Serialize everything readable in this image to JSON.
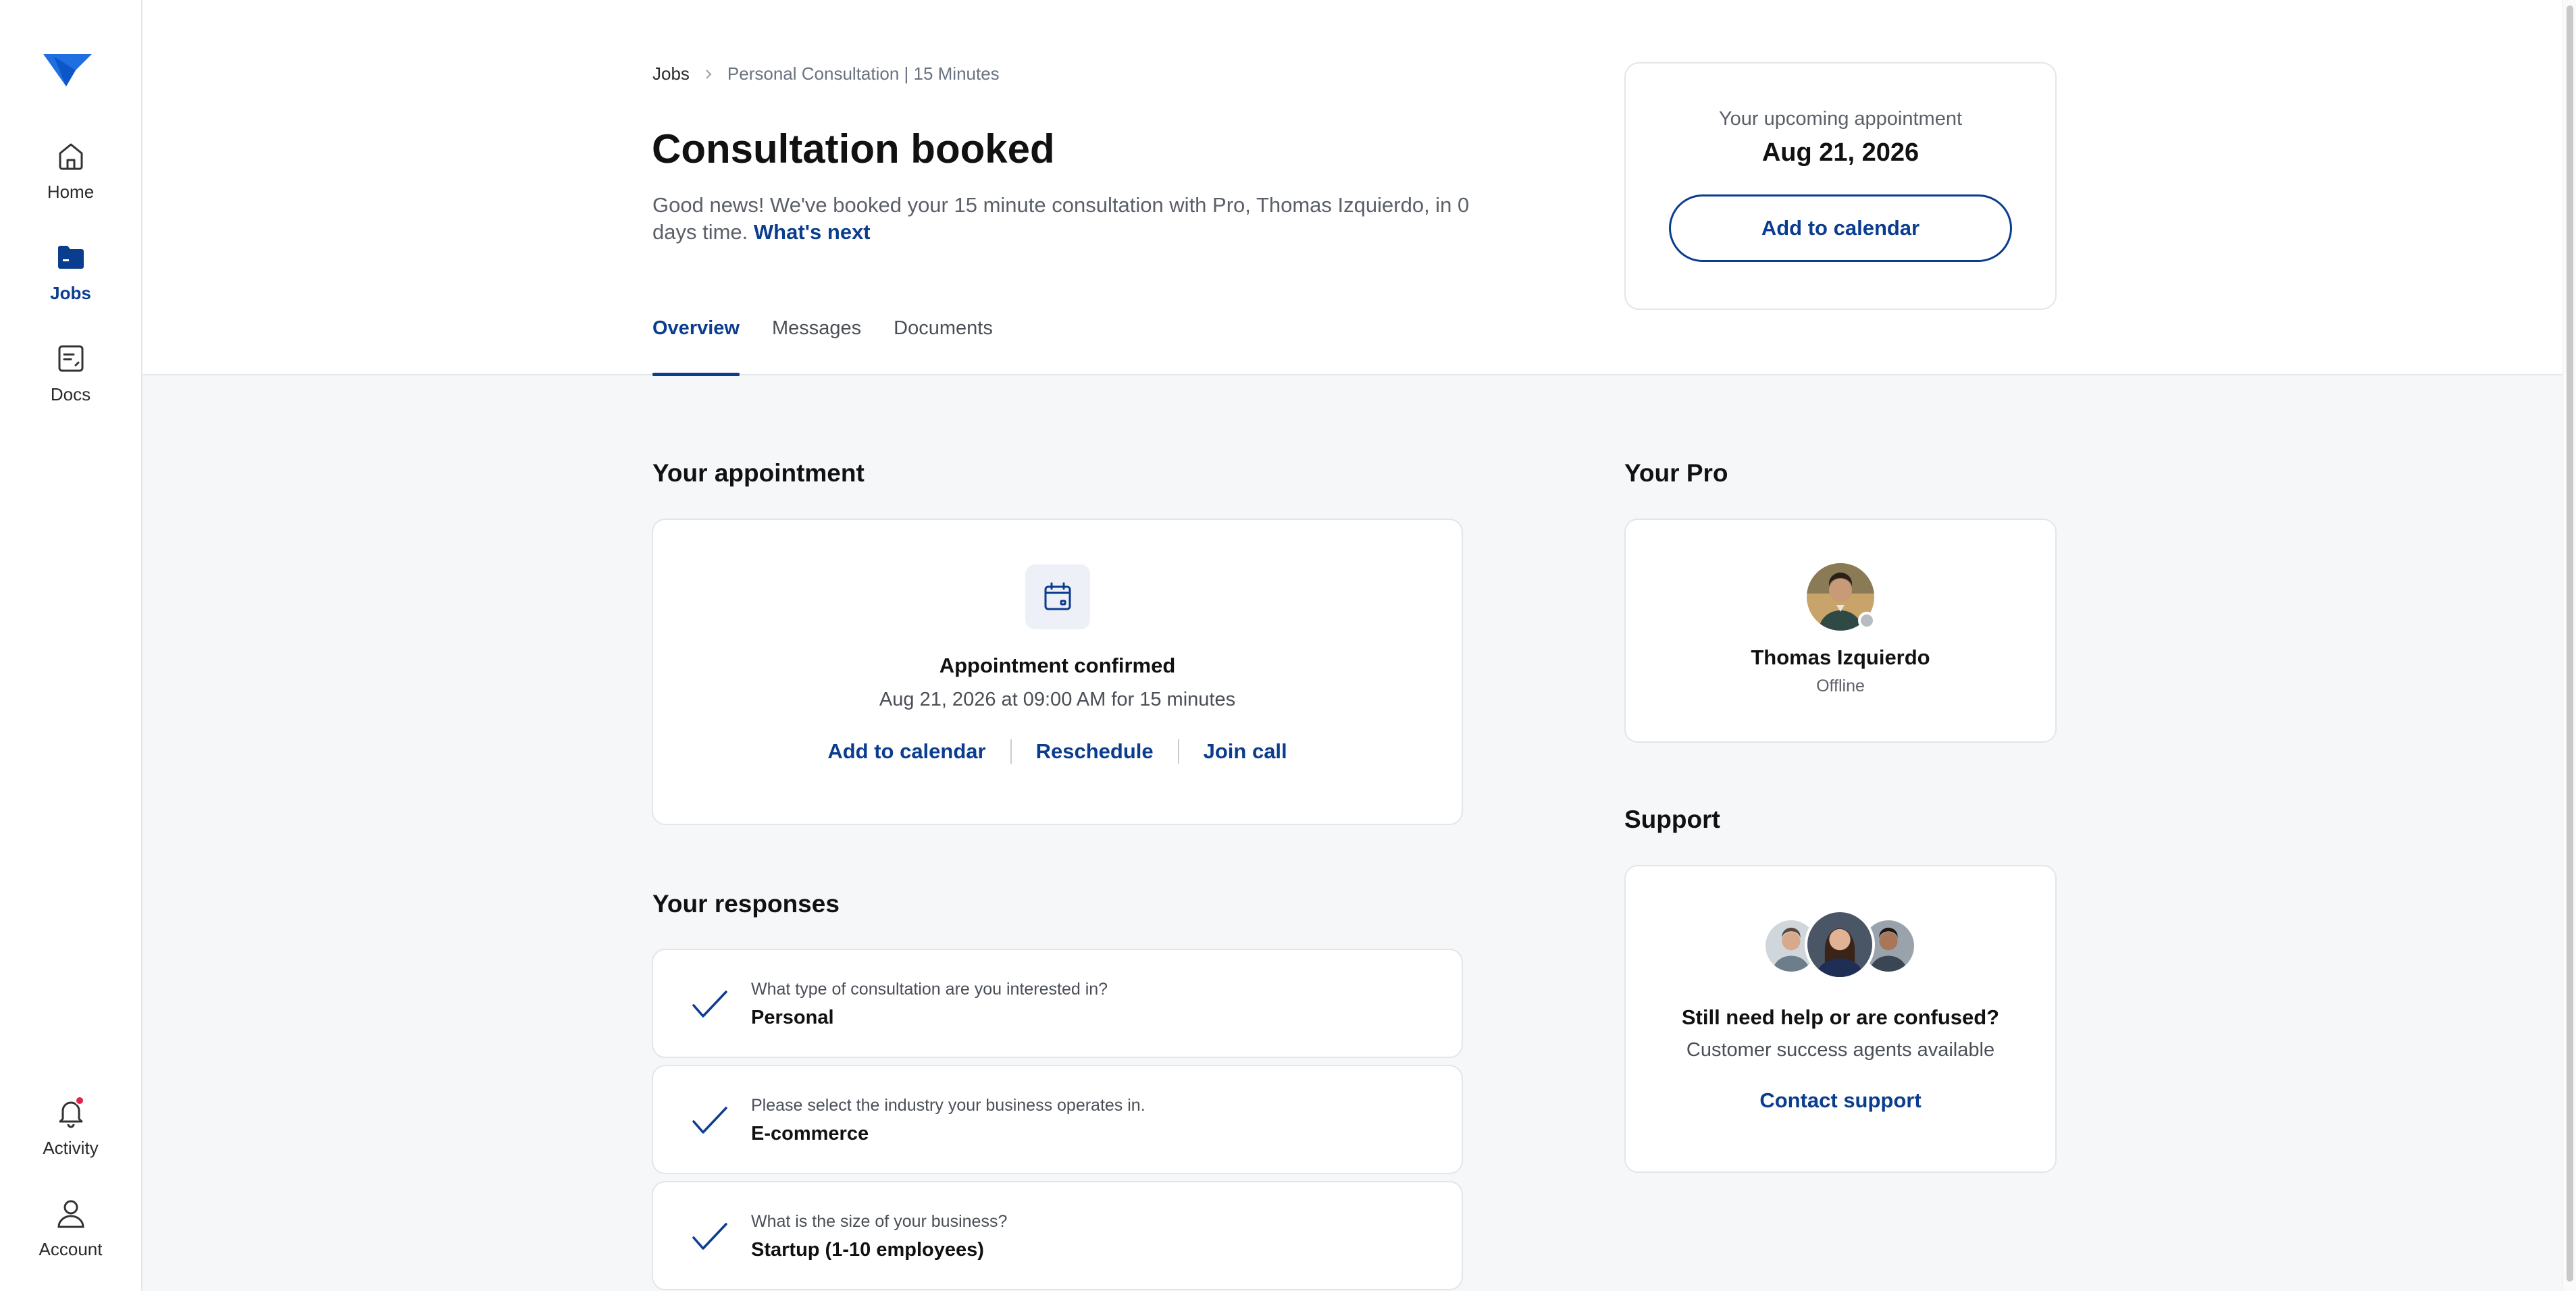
{
  "colors": {
    "accent": "#0b3d8f",
    "logo": "#1f6fe0",
    "notification": "#e0234e",
    "offline": "#b8bcc2"
  },
  "sidebar": {
    "logo_icon": "brand-check-logo",
    "items": [
      {
        "label": "Home",
        "icon": "home-icon",
        "active": false
      },
      {
        "label": "Jobs",
        "icon": "folder-icon",
        "active": true
      },
      {
        "label": "Docs",
        "icon": "document-icon",
        "active": false
      },
      {
        "label": "Activity",
        "icon": "bell-icon",
        "active": false,
        "has_notification": true
      },
      {
        "label": "Account",
        "icon": "user-icon",
        "active": false
      }
    ]
  },
  "breadcrumb": {
    "root": "Jobs",
    "separator_icon": "chevron-right-icon",
    "current": "Personal Consultation | 15 Minutes"
  },
  "header": {
    "title": "Consultation booked",
    "subtitle": "Good news! We've booked your 15 minute consultation with Pro, Thomas Izquierdo, in 0 days time.",
    "subtitle_link": "What's next"
  },
  "tabs": [
    {
      "label": "Overview",
      "active": true
    },
    {
      "label": "Messages",
      "active": false
    },
    {
      "label": "Documents",
      "active": false
    }
  ],
  "upcoming": {
    "label": "Your upcoming appointment",
    "date": "Aug 21, 2026",
    "button": "Add to calendar"
  },
  "appointment": {
    "heading": "Your appointment",
    "icon": "calendar-icon",
    "title": "Appointment confirmed",
    "detail": "Aug 21, 2026 at 09:00 AM for 15 minutes",
    "actions": [
      "Add to calendar",
      "Reschedule",
      "Join call"
    ]
  },
  "responses": {
    "heading": "Your responses",
    "items": [
      {
        "question": "What type of consultation are you interested in?",
        "answer": "Personal"
      },
      {
        "question": "Please select the industry your business operates in.",
        "answer": "E-commerce"
      },
      {
        "question": "What is the size of your business?",
        "answer": "Startup (1-10 employees)"
      }
    ]
  },
  "pro": {
    "heading": "Your Pro",
    "name": "Thomas Izquierdo",
    "status": "Offline"
  },
  "support": {
    "heading": "Support",
    "title": "Still need help or are confused?",
    "subtitle": "Customer success agents available",
    "link": "Contact support"
  }
}
